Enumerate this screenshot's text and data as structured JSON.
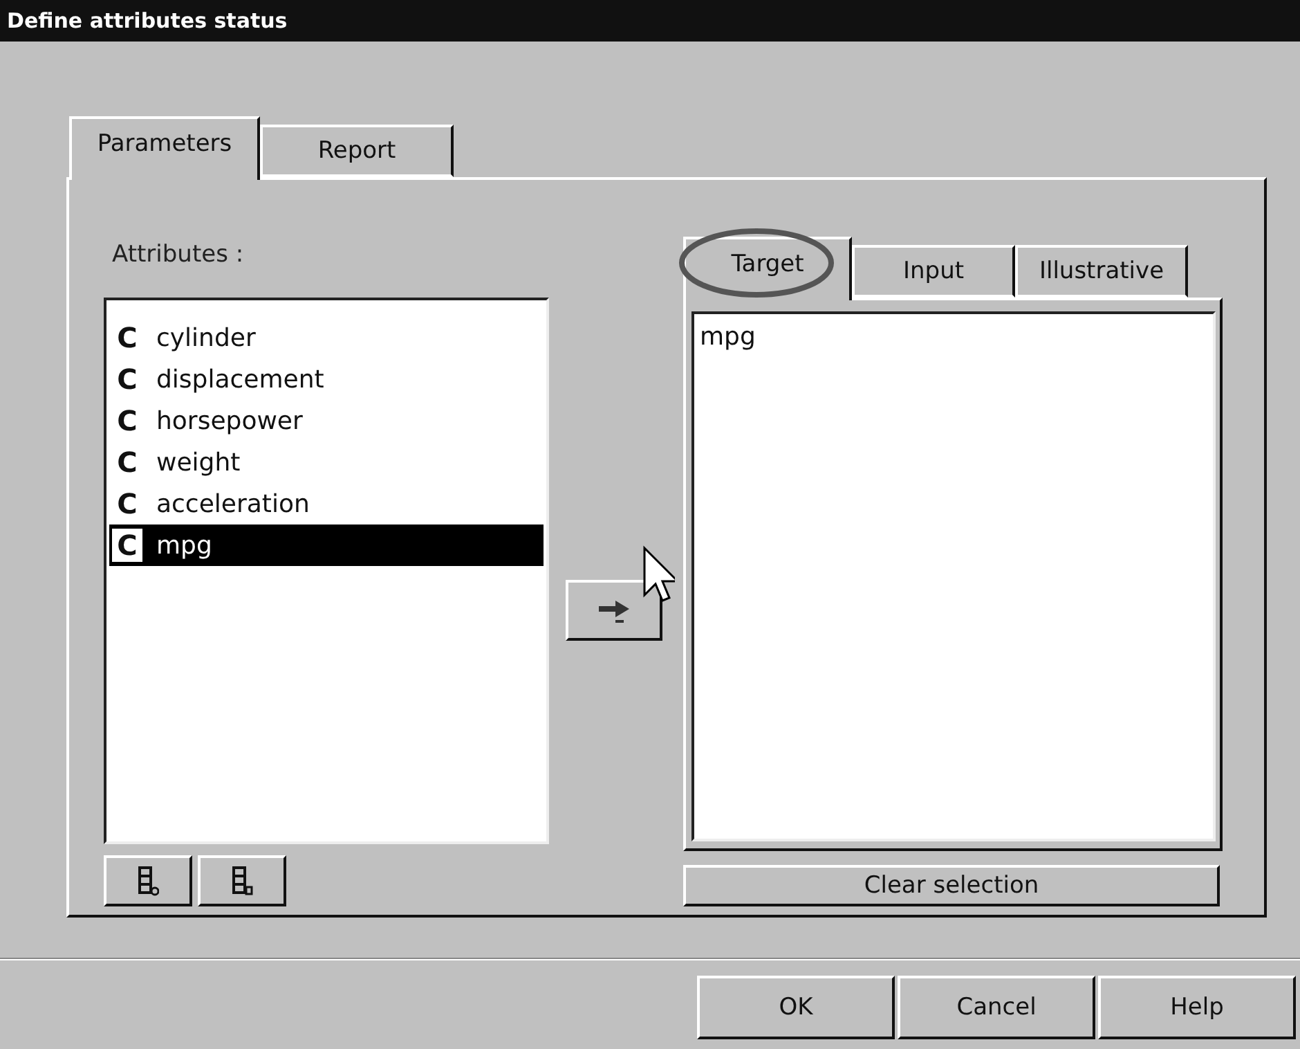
{
  "window": {
    "title": "Define attributes status"
  },
  "tabs": [
    {
      "label": "Parameters",
      "selected": true
    },
    {
      "label": "Report",
      "selected": false
    }
  ],
  "attributes": {
    "label": "Attributes :",
    "items": [
      {
        "type": "C",
        "name": "cylinder",
        "selected": false
      },
      {
        "type": "C",
        "name": "displacement",
        "selected": false
      },
      {
        "type": "C",
        "name": "horsepower",
        "selected": false
      },
      {
        "type": "C",
        "name": "weight",
        "selected": false
      },
      {
        "type": "C",
        "name": "acceleration",
        "selected": false
      },
      {
        "type": "C",
        "name": "mpg",
        "selected": true
      }
    ]
  },
  "role_tabs": [
    {
      "label": "Target",
      "selected": true,
      "circled": true
    },
    {
      "label": "Input",
      "selected": false,
      "circled": false
    },
    {
      "label": "Illustrative",
      "selected": false,
      "circled": false
    }
  ],
  "target_list": {
    "items": [
      "mpg"
    ]
  },
  "clear_button": "Clear selection",
  "buttons": [
    "OK",
    "Cancel",
    "Help"
  ]
}
